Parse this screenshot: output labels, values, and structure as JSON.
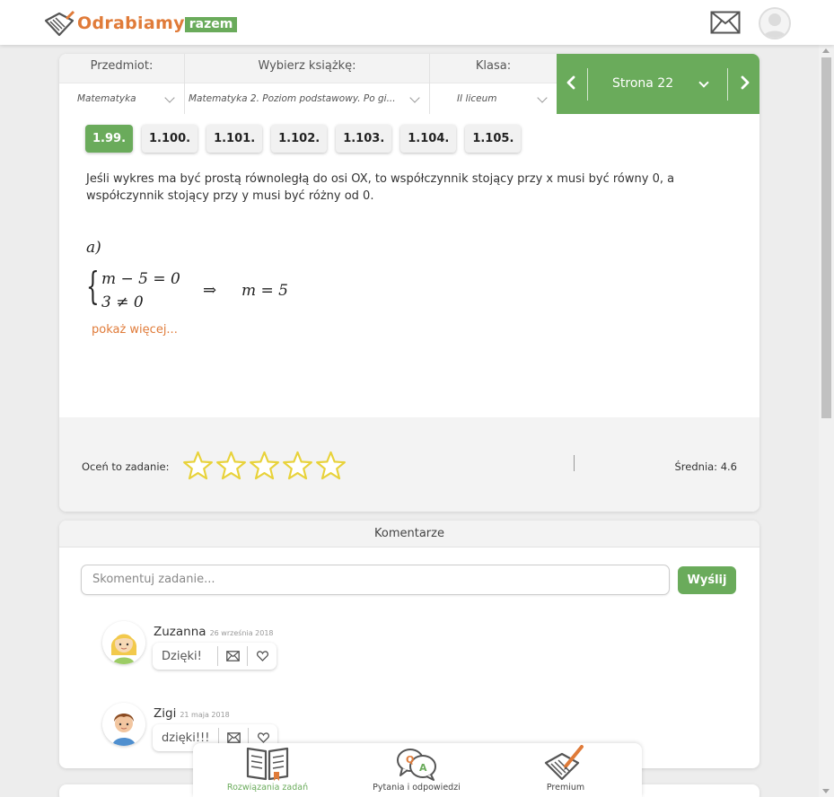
{
  "header": {
    "logo_text": "Odrabiamy",
    "logo_badge": "razem",
    "mail_icon": "envelope-icon",
    "avatar_icon": "user-avatar-icon"
  },
  "selectors": {
    "subject": {
      "title": "Przedmiot:",
      "value": "Matematyka"
    },
    "book": {
      "title": "Wybierz książkę:",
      "value": "Matematyka 2. Poziom podstawowy. Po gi..."
    },
    "grade": {
      "title": "Klasa:",
      "value": "II liceum"
    },
    "page": {
      "label": "Strona 22"
    }
  },
  "tasks": [
    "1.99.",
    "1.100.",
    "1.101.",
    "1.102.",
    "1.103.",
    "1.104.",
    "1.105."
  ],
  "active_task": "1.99.",
  "solution": {
    "explanation": "Jeśli wykres ma być prostą równoległą do osi OX, to współczynnik stojący przy x musi być równy 0, a współczynnik stojący przy y musi być różny od 0.",
    "part_label": "a)",
    "line1": "m − 5 = 0",
    "line2": "3 ≠ 0",
    "arrow": "⇒",
    "result": "m = 5",
    "more_link": "pokaż więcej..."
  },
  "rating": {
    "label": "Oceń to zadanie:",
    "stars_total": 5,
    "stars_filled": 0,
    "average": "Średnia: 4.6"
  },
  "comments": {
    "title": "Komentarze",
    "placeholder": "Skomentuj zadanie...",
    "send_label": "Wyślij",
    "items": [
      {
        "name": "Zuzanna",
        "date": "26 września 2018",
        "text": "Dzięki!"
      },
      {
        "name": "Zigi",
        "date": "21 maja 2018",
        "text": "dzięki!!!"
      }
    ]
  },
  "bottom_nav": [
    {
      "label": "Rozwiązania zadań",
      "icon": "book-icon",
      "active": true
    },
    {
      "label": "Pytania i odpowiedzi",
      "icon": "qa-bubbles-icon",
      "active": false
    },
    {
      "label": "Premium",
      "icon": "premium-notebook-icon",
      "active": false
    }
  ],
  "colors": {
    "accent_green": "#6aab5b",
    "accent_orange": "#e07b39",
    "star_yellow": "#e8d23a"
  }
}
